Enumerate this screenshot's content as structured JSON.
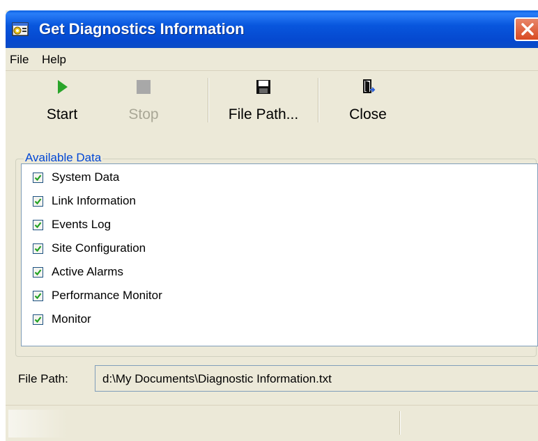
{
  "window": {
    "title": "Get Diagnostics Information"
  },
  "menu": [
    {
      "label": "File"
    },
    {
      "label": "Help"
    }
  ],
  "toolbar": {
    "start_label": "Start",
    "stop_label": "Stop",
    "filepath_label": "File Path...",
    "close_label": "Close"
  },
  "available_data": {
    "legend": "Available Data",
    "items": [
      {
        "label": "System Data",
        "checked": true
      },
      {
        "label": "Link Information",
        "checked": true
      },
      {
        "label": "Events Log",
        "checked": true
      },
      {
        "label": "Site Configuration",
        "checked": true
      },
      {
        "label": "Active Alarms",
        "checked": true
      },
      {
        "label": "Performance Monitor",
        "checked": true
      },
      {
        "label": "Monitor",
        "checked": true
      }
    ]
  },
  "file_path": {
    "label": "File Path:",
    "value": "d:\\My Documents\\Diagnostic Information.txt"
  },
  "colors": {
    "titlebar": "#0a5fe0",
    "start_icon": "#2aa52a",
    "legend_text": "#0046d5",
    "checkmark": "#21a121"
  },
  "icons": {
    "app": "app-icon",
    "start": "play-icon",
    "stop": "stop-icon",
    "file_path": "floppy-disk-icon",
    "close": "door-exit-icon",
    "window_close": "close-icon"
  }
}
